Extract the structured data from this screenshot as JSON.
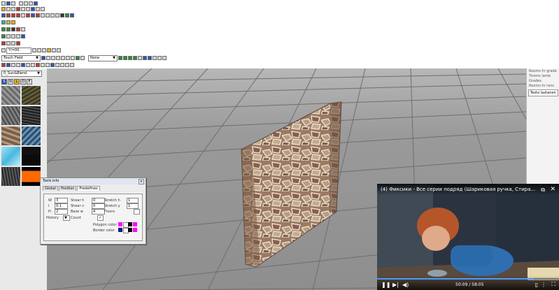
{
  "toolbar": {
    "scale_value": "Y/=00.",
    "layer_combo": "Touch Field",
    "view_combo": "None"
  },
  "texture_panel": {
    "combo": "0_Sun&Blend",
    "tabs": [
      "S",
      "N",
      "L",
      "D",
      "F"
    ]
  },
  "right_panel": {
    "lines": [
      "Rooms hr grade",
      "Tiroms lamb",
      "Grades",
      "Rooms hr ranc"
    ],
    "box": "Texto laxtanen"
  },
  "tools_info": {
    "title": "Tools info",
    "tabs": [
      "Global",
      "Position",
      "Predefines"
    ],
    "labels": {
      "w": "W",
      "l": "l",
      "h": "H",
      "shear_h": "Shear h",
      "shear_v": "Shear v",
      "base_w": "Base w",
      "stretch_h": "Stretch h",
      "stretch_v": "Stretch y",
      "floors": "Floors",
      "history": "History",
      "count": "Count",
      "polygon_color": "Polygon color",
      "border_color": "Border color"
    },
    "values": {
      "w": "3",
      "l": "0.1",
      "h": "2",
      "shear_h": "0",
      "shear_v": "0",
      "base_w": "4",
      "stretch_h": "1",
      "stretch_v": "1",
      "history": ""
    },
    "colors": {
      "pink": "#ff00ff",
      "white": "#ffffff",
      "black": "#000000",
      "blue": "#1a1a7a"
    }
  },
  "video": {
    "title": "(4) Фиксики - Все серии подряд (Шариковая ручка, Стира...",
    "time": "50:09 / 58:05"
  }
}
